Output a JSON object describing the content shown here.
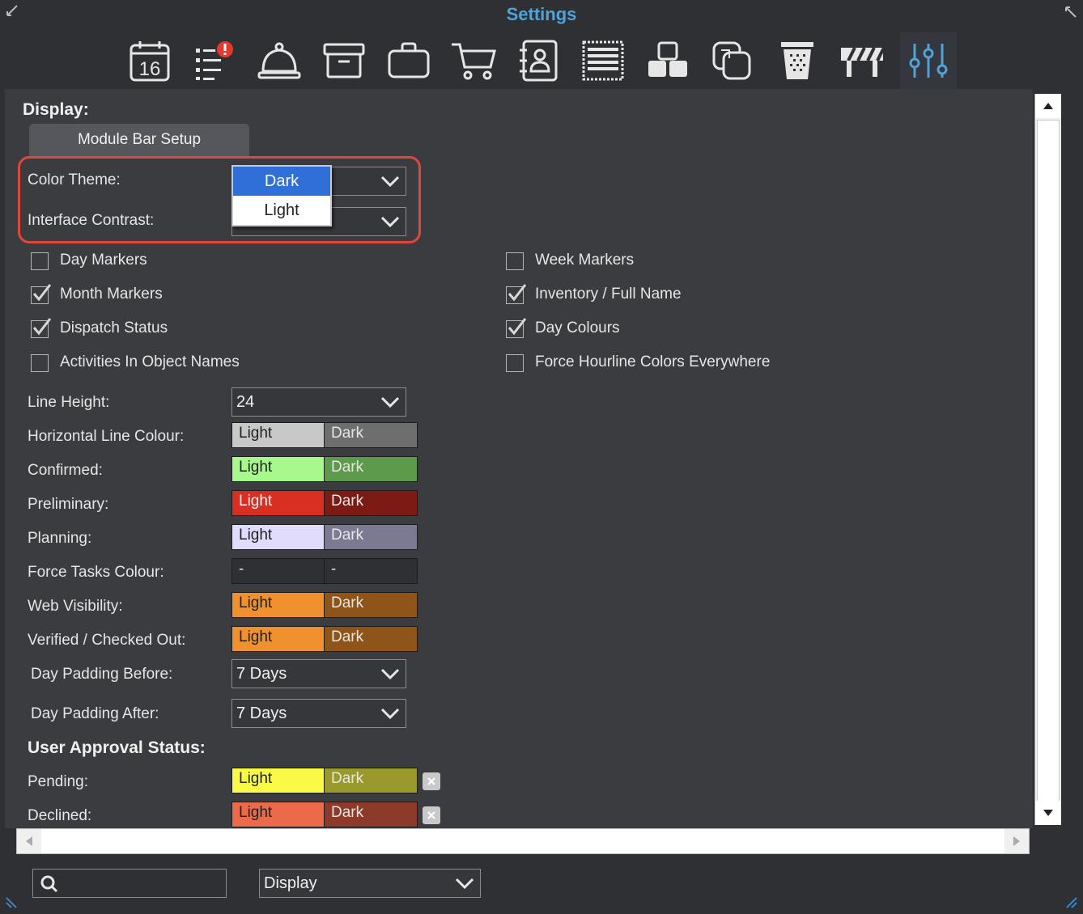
{
  "window": {
    "title": "Settings"
  },
  "toolbar": {
    "icons": [
      {
        "name": "calendar-icon",
        "text": "16"
      },
      {
        "name": "task-list-icon"
      },
      {
        "name": "service-bell-icon"
      },
      {
        "name": "archive-box-icon"
      },
      {
        "name": "briefcase-icon"
      },
      {
        "name": "shopping-cart-icon"
      },
      {
        "name": "contacts-icon"
      },
      {
        "name": "list-panel-icon"
      },
      {
        "name": "boxes-icon"
      },
      {
        "name": "copy-icon"
      },
      {
        "name": "trash-bin-icon"
      },
      {
        "name": "barrier-icon"
      },
      {
        "name": "sliders-icon",
        "active": true
      }
    ]
  },
  "display": {
    "heading": "Display:",
    "module_bar_button": "Module Bar Setup",
    "color_theme": {
      "label": "Color Theme:",
      "options": [
        "Dark",
        "Light"
      ],
      "selected": "Dark"
    },
    "interface_contrast": {
      "label": "Interface Contrast:"
    },
    "checkboxes_left": [
      {
        "label": "Day Markers",
        "checked": false
      },
      {
        "label": "Month Markers",
        "checked": true
      },
      {
        "label": "Dispatch Status",
        "checked": true
      },
      {
        "label": "Activities In Object Names",
        "checked": false
      }
    ],
    "checkboxes_right": [
      {
        "label": "Week Markers",
        "checked": false
      },
      {
        "label": "Inventory / Full Name",
        "checked": true
      },
      {
        "label": "Day Colours",
        "checked": true
      },
      {
        "label": "Force Hourline Colors Everywhere",
        "checked": false
      }
    ],
    "line_height": {
      "label": "Line Height:",
      "value": "24"
    },
    "colour_rows": [
      {
        "label": "Horizontal Line Colour:",
        "light": "Light",
        "dark": "Dark",
        "light_color": "#c8c8c8",
        "dark_color": "#6e6e6e",
        "light_text": "#222222",
        "dark_text": "#e6e6e6"
      },
      {
        "label": "Confirmed:",
        "light": "Light",
        "dark": "Dark",
        "light_color": "#a8f98c",
        "dark_color": "#5e9a4c",
        "light_text": "#222222",
        "dark_text": "#e6e6e6"
      },
      {
        "label": "Preliminary:",
        "light": "Light",
        "dark": "Dark",
        "light_color": "#d92e22",
        "dark_color": "#7c1a14",
        "light_text": "#f0f0f0",
        "dark_text": "#e6e6e6"
      },
      {
        "label": "Planning:",
        "light": "Light",
        "dark": "Dark",
        "light_color": "#e1dcfb",
        "dark_color": "#7c7a92",
        "light_text": "#222222",
        "dark_text": "#e6e6e6"
      },
      {
        "label": "Force Tasks Colour:",
        "light": "-",
        "dark": "-",
        "light_color": "#2f3034",
        "dark_color": "#2f3034",
        "light_text": "#e6e6e6",
        "dark_text": "#e6e6e6"
      },
      {
        "label": "Web Visibility:",
        "light": "Light",
        "dark": "Dark",
        "light_color": "#f0902e",
        "dark_color": "#8e5418",
        "light_text": "#222222",
        "dark_text": "#e6e6e6"
      },
      {
        "label": "Verified / Checked Out:",
        "light": "Light",
        "dark": "Dark",
        "light_color": "#f0902e",
        "dark_color": "#8e5418",
        "light_text": "#222222",
        "dark_text": "#e6e6e6"
      }
    ],
    "day_padding_before": {
      "label": "Day Padding Before:",
      "value": "7 Days"
    },
    "day_padding_after": {
      "label": "Day Padding After:",
      "value": "7 Days"
    }
  },
  "user_approval": {
    "heading": "User Approval Status:",
    "rows": [
      {
        "label": "Pending:",
        "light": "Light",
        "dark": "Dark",
        "light_color": "#fafa46",
        "dark_color": "#9a9a2c",
        "light_text": "#222222",
        "dark_text": "#e6e6e6"
      },
      {
        "label": "Declined:",
        "light": "Light",
        "dark": "Dark",
        "light_color": "#ea6a4a",
        "dark_color": "#8e3a2a",
        "light_text": "#222222",
        "dark_text": "#e6e6e6"
      }
    ]
  },
  "bottom": {
    "search_placeholder": "",
    "section_select": "Display"
  },
  "colors": {
    "accent": "#4fa3d6",
    "highlight": "#e0473a",
    "selected_option": "#2f6fd8"
  }
}
